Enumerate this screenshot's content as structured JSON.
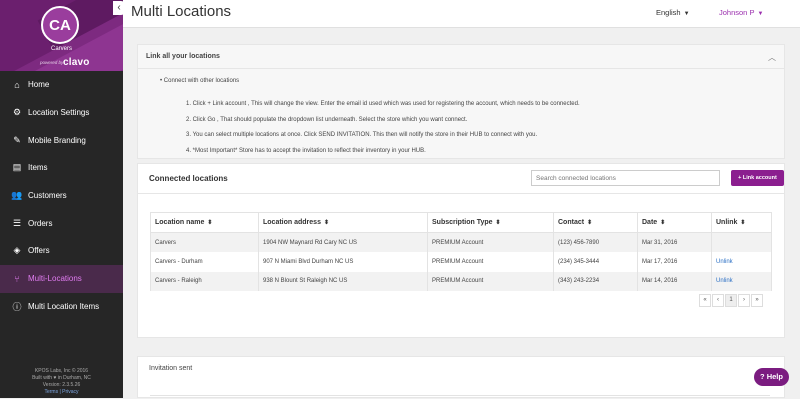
{
  "sidebar": {
    "avatar_initials": "CA",
    "store_name": "Carvers",
    "powered_by": "powered by",
    "brand_logo": "clavo",
    "collapse_icon": "chevron-left-icon",
    "items": [
      {
        "label": "Home",
        "icon": "home-icon"
      },
      {
        "label": "Location Settings",
        "icon": "gear-icon"
      },
      {
        "label": "Mobile Branding",
        "icon": "brush-icon"
      },
      {
        "label": "Items",
        "icon": "items-icon"
      },
      {
        "label": "Customers",
        "icon": "users-icon"
      },
      {
        "label": "Orders",
        "icon": "list-icon"
      },
      {
        "label": "Offers",
        "icon": "tag-icon"
      },
      {
        "label": "Multi-Locations",
        "icon": "branch-icon",
        "active": true
      },
      {
        "label": "Multi Location Items",
        "icon": "info-icon"
      }
    ],
    "footer": {
      "copyright": "KPOS Labs, Inc © 2016",
      "built_with": "Built with ♥ in Durham, NC",
      "version": "Version: 2.3.5.26",
      "links": "Terms | Privacy"
    }
  },
  "header": {
    "title": "Multi Locations",
    "language": "English",
    "user": "Johnson P"
  },
  "info_panel": {
    "title": "Link all your locations",
    "bullet": "Connect with other locations",
    "steps": [
      "1. Click + Link account , This will change the view. Enter the email id used which was used for registering the account, which needs to be connected.",
      "2. Click Go , That should populate the dropdown list underneath. Select the store which you want connect.",
      "3. You can select multiple locations at once. Click SEND INVITATION. This then will notify the store in their HUB to connect with you.",
      "4. *Most Important* Store has to accept the invitation to reflect their inventory in your HUB."
    ]
  },
  "connected": {
    "title": "Connected locations",
    "search_placeholder": "Search connected locations",
    "link_button": "+ Link account",
    "columns": [
      "Location name",
      "Location address",
      "Subscription Type",
      "Contact",
      "Date",
      "Unlink"
    ],
    "rows": [
      {
        "name": "Carvers",
        "address": "1904 NW Maynard Rd Cary NC US",
        "subscription": "PREMIUM Account",
        "contact": "(123) 456-7890",
        "date": "Mar 31, 2016",
        "unlink": ""
      },
      {
        "name": "Carvers - Durham",
        "address": "907 N Miami Blvd Durham NC US",
        "subscription": "PREMIUM Account",
        "contact": "(234) 345-3444",
        "date": "Mar 17, 2016",
        "unlink": "Unlink"
      },
      {
        "name": "Carvers - Raleigh",
        "address": "938 N Blount St Raleigh NC US",
        "subscription": "PREMIUM Account",
        "contact": "(343) 243-2234",
        "date": "Mar 14, 2016",
        "unlink": "Unlink"
      }
    ],
    "pager": {
      "first": "«",
      "prev": "‹",
      "current": "1",
      "next": "›",
      "last": "»"
    }
  },
  "invitations": {
    "title": "Invitation sent"
  },
  "help_button": "? Help",
  "colors": {
    "accent": "#8b1e8f",
    "sidebar_bg": "#262626",
    "link": "#2a6fc4"
  }
}
